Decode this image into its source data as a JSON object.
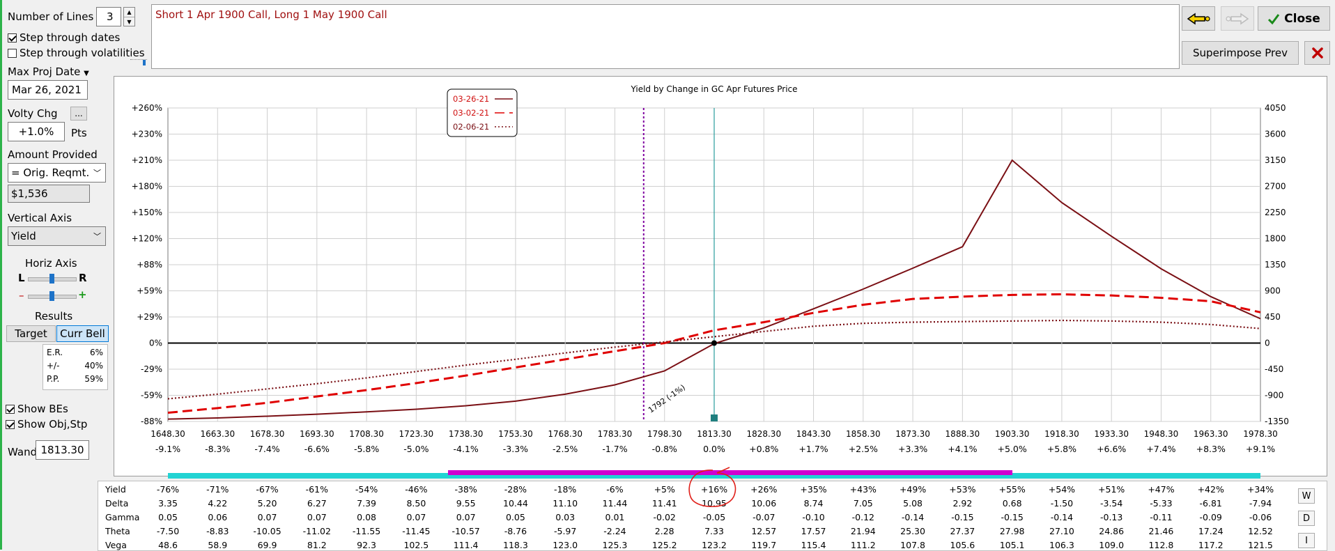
{
  "controls": {
    "number_of_lines_label": "Number of Lines",
    "number_of_lines_value": "3",
    "step_dates_label": "Step through dates",
    "step_dates_checked": true,
    "step_vols_label": "Step through volatilities",
    "step_vols_checked": false,
    "max_proj_date_label": "Max Proj Date",
    "max_proj_date_value": "Mar 26, 2021",
    "volty_chg_label": "Volty Chg",
    "volty_more_button": "...",
    "volty_chg_value": "+1.0%",
    "volty_units": "Pts",
    "amount_provided_label": "Amount Provided",
    "amount_provided_value": "= Orig. Reqmt.",
    "amount_value": "$1,536",
    "vertical_axis_label": "Vertical Axis",
    "vertical_axis_value": "Yield",
    "horiz_axis_label": "Horiz Axis",
    "horiz_left": "L",
    "horiz_right": "R",
    "zoom_minus": "–",
    "zoom_plus": "+",
    "results_label": "Results",
    "target_button": "Target",
    "curr_bell_button": "Curr Bell",
    "er_label": "E.R.",
    "er_value": "6%",
    "pm_label": "+/-",
    "pm_value": "40%",
    "pp_label": "P.P.",
    "pp_value": "59%",
    "show_bes_label": "Show BEs",
    "show_bes_checked": true,
    "show_obj_label": "Show Obj,Stp",
    "show_obj_checked": true,
    "wand_label": "Wand",
    "wand_value": "1813.30"
  },
  "description_text": "Short 1 Apr 1900 Call, Long 1 May 1900 Call",
  "toolbar": {
    "close_label": "Close",
    "superimpose_label": "Superimpose Prev",
    "back_icon": "arrow-left-icon",
    "forward_icon": "arrow-right-icon",
    "delete_icon": "red-x-icon"
  },
  "colors": {
    "primary_line": "#7a0f14",
    "dashed_line": "#e00000",
    "dotted_line": "#7a0f14",
    "wand_line": "#2a9d9d",
    "breakeven_line": "#8000a0",
    "bar_cyan": "#22d3d3",
    "bar_magenta": "#d000d0"
  },
  "chart_data": {
    "type": "line",
    "title": "Yield by Change in GC Apr Futures Price",
    "x": [
      1648.3,
      1663.3,
      1678.3,
      1693.3,
      1708.3,
      1723.3,
      1738.3,
      1753.3,
      1768.3,
      1783.3,
      1798.3,
      1813.3,
      1828.3,
      1843.3,
      1858.3,
      1873.3,
      1888.3,
      1903.3,
      1918.3,
      1933.3,
      1948.3,
      1963.3,
      1978.3
    ],
    "x_tick_labels": [
      "1648.30",
      "1663.30",
      "1678.30",
      "1693.30",
      "1708.30",
      "1723.30",
      "1738.30",
      "1753.30",
      "1768.30",
      "1783.30",
      "1798.30",
      "1813.30",
      "1828.30",
      "1843.30",
      "1858.30",
      "1873.30",
      "1888.30",
      "1903.30",
      "1918.30",
      "1933.30",
      "1948.30",
      "1963.30",
      "1978.30"
    ],
    "x_pct_labels": [
      "-9.1%",
      "-8.3%",
      "-7.4%",
      "-6.6%",
      "-5.8%",
      "-5.0%",
      "-4.1%",
      "-3.3%",
      "-2.5%",
      "-1.7%",
      "-0.8%",
      "0.0%",
      "+0.8%",
      "+1.7%",
      "+2.5%",
      "+3.3%",
      "+4.1%",
      "+5.0%",
      "+5.8%",
      "+6.6%",
      "+7.4%",
      "+8.3%",
      "+9.1%"
    ],
    "y_left_ticks": [
      "+260%",
      "+230%",
      "+210%",
      "+180%",
      "+150%",
      "+120%",
      "+88%",
      "+59%",
      "+29%",
      "0%",
      "-29%",
      "-59%",
      "-88%"
    ],
    "y_right_ticks": [
      "4050",
      "3600",
      "3150",
      "2700",
      "2250",
      "1800",
      "1350",
      "900",
      "450",
      "0",
      "-450",
      "-900",
      "-1350"
    ],
    "ylim": [
      -1350,
      4050
    ],
    "xlim": [
      1648.3,
      1978.3
    ],
    "grid": true,
    "legend_position": "top-left",
    "series": [
      {
        "name": "03-26-21",
        "style": "solid",
        "values": [
          -1310,
          -1290,
          -1260,
          -1225,
          -1185,
          -1140,
          -1080,
          -1000,
          -880,
          -720,
          -480,
          -10,
          260,
          590,
          930,
          1290,
          1660,
          3150,
          2420,
          1840,
          1280,
          800,
          420
        ]
      },
      {
        "name": "03-02-21",
        "style": "dashed",
        "values": [
          -1200,
          -1120,
          -1030,
          -920,
          -810,
          -690,
          -560,
          -420,
          -280,
          -140,
          0,
          220,
          360,
          520,
          660,
          760,
          800,
          830,
          840,
          820,
          780,
          720,
          530
        ]
      },
      {
        "name": "02-06-21",
        "style": "dotted",
        "values": [
          -960,
          -880,
          -790,
          -700,
          -600,
          -490,
          -380,
          -280,
          -170,
          -70,
          20,
          110,
          200,
          290,
          340,
          360,
          370,
          380,
          390,
          380,
          360,
          320,
          250
        ]
      }
    ],
    "annotations": [
      {
        "text": "1792 (-1%)",
        "x": 1792
      }
    ]
  },
  "table": {
    "row_labels": [
      "Yield",
      "Delta",
      "Gamma",
      "Theta",
      "Vega"
    ],
    "rows": [
      [
        "-76%",
        "-71%",
        "-67%",
        "-61%",
        "-54%",
        "-46%",
        "-38%",
        "-28%",
        "-18%",
        "-6%",
        "+5%",
        "+16%",
        "+26%",
        "+35%",
        "+43%",
        "+49%",
        "+53%",
        "+55%",
        "+54%",
        "+51%",
        "+47%",
        "+42%",
        "+34%"
      ],
      [
        "3.35",
        "4.22",
        "5.20",
        "6.27",
        "7.39",
        "8.50",
        "9.55",
        "10.44",
        "11.10",
        "11.44",
        "11.41",
        "10.95",
        "10.06",
        "8.74",
        "7.05",
        "5.08",
        "2.92",
        "0.68",
        "-1.50",
        "-3.54",
        "-5.33",
        "-6.81",
        "-7.94"
      ],
      [
        "0.05",
        "0.06",
        "0.07",
        "0.07",
        "0.08",
        "0.07",
        "0.07",
        "0.05",
        "0.03",
        "0.01",
        "-0.02",
        "-0.05",
        "-0.07",
        "-0.10",
        "-0.12",
        "-0.14",
        "-0.15",
        "-0.15",
        "-0.14",
        "-0.13",
        "-0.11",
        "-0.09",
        "-0.06"
      ],
      [
        "-7.50",
        "-8.83",
        "-10.05",
        "-11.02",
        "-11.55",
        "-11.45",
        "-10.57",
        "-8.76",
        "-5.97",
        "-2.24",
        "2.28",
        "7.33",
        "12.57",
        "17.57",
        "21.94",
        "25.30",
        "27.37",
        "27.98",
        "27.10",
        "24.86",
        "21.46",
        "17.24",
        "12.52"
      ],
      [
        "48.6",
        "58.9",
        "69.9",
        "81.2",
        "92.3",
        "102.5",
        "111.4",
        "118.3",
        "123.0",
        "125.3",
        "125.2",
        "123.2",
        "119.7",
        "115.4",
        "111.2",
        "107.8",
        "105.6",
        "105.1",
        "106.3",
        "109.0",
        "112.8",
        "117.2",
        "121.5"
      ]
    ],
    "side_buttons": [
      "W",
      "D",
      "I"
    ]
  }
}
